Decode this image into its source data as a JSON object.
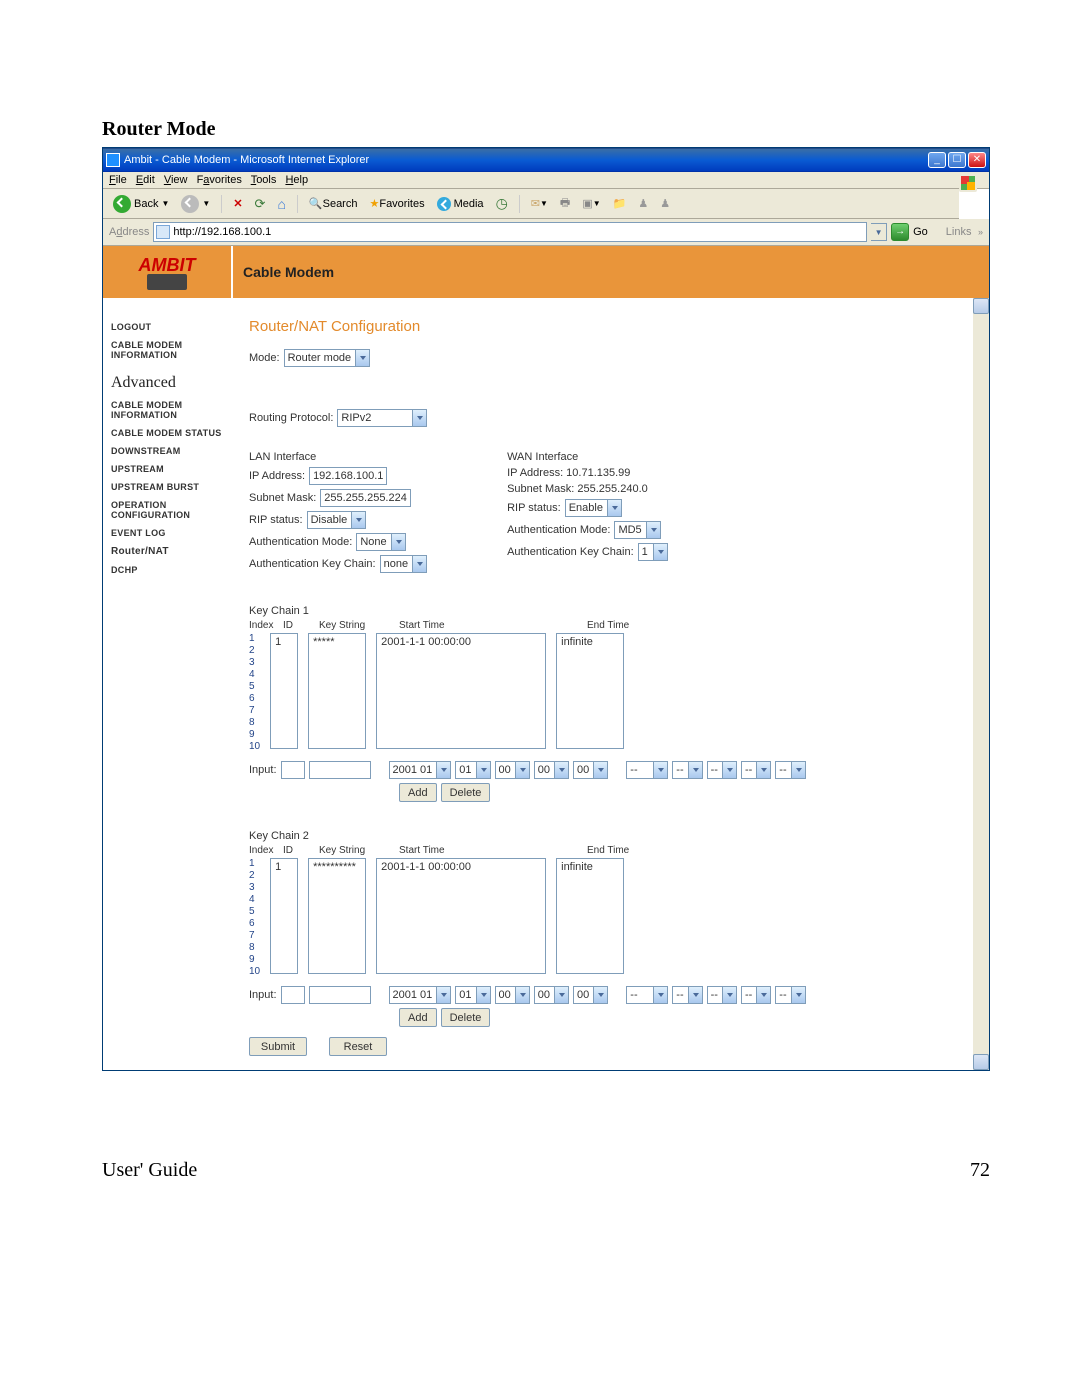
{
  "doc": {
    "heading": "Router Mode",
    "footer_left": "User' Guide",
    "footer_right": "72"
  },
  "window": {
    "title": "Ambit - Cable Modem - Microsoft Internet Explorer"
  },
  "menu": {
    "file": "File",
    "edit": "Edit",
    "view": "View",
    "fav": "Favorites",
    "tools": "Tools",
    "help": "Help"
  },
  "tb": {
    "back": "Back",
    "search": "Search",
    "favorites": "Favorites",
    "media": "Media"
  },
  "addr": {
    "label": "Address",
    "value": "http://192.168.100.1",
    "go": "Go",
    "links": "Links"
  },
  "brand": {
    "logo": "AMBIT",
    "banner": "Cable Modem"
  },
  "nav": {
    "i0": "LOGOUT",
    "i1": "CABLE MODEM INFORMATION",
    "adv": "Advanced",
    "i2": "CABLE MODEM INFORMATION",
    "i3": "CABLE MODEM STATUS",
    "i4": "DOWNSTREAM",
    "i5": "UPSTREAM",
    "i6": "UPSTREAM BURST",
    "i7": "OPERATION CONFIGURATION",
    "i8": "EVENT LOG",
    "i9": "Router/NAT",
    "i10": "DCHP"
  },
  "cfg": {
    "title": "Router/NAT Configuration",
    "mode_label": "Mode:",
    "mode_value": "Router mode",
    "rp_label": "Routing Protocol:",
    "rp_value": "RIPv2",
    "lan": {
      "title": "LAN Interface",
      "ip_label": "IP Address:",
      "ip": "192.168.100.1",
      "mask_label": "Subnet Mask:",
      "mask": "255.255.255.224",
      "rip_label": "RIP status:",
      "rip": "Disable",
      "auth_label": "Authentication Mode:",
      "auth": "None",
      "akc_label": "Authentication Key Chain:",
      "akc": "none"
    },
    "wan": {
      "title": "WAN Interface",
      "ip_label": "IP Address: 10.71.135.99",
      "mask_label": "Subnet Mask: 255.255.240.0",
      "rip_label": "RIP status:",
      "rip": "Enable",
      "auth_label": "Authentication Mode:",
      "auth": "MD5",
      "akc_label": "Authentication Key Chain:",
      "akc": "1"
    }
  },
  "kc1": {
    "title": "Key Chain 1",
    "hdr": {
      "index": "Index",
      "id": "ID",
      "ks": "Key String",
      "st": "Start Time",
      "et": "End Time"
    },
    "id": "1",
    "ks": "*****",
    "st": "2001-1-1 00:00:00",
    "et": "infinite",
    "input_label": "Input:",
    "s1": "2001 01",
    "s2": "01",
    "s3": "00",
    "s4": "00",
    "s5": "00",
    "dd": "--",
    "add": "Add",
    "del": "Delete"
  },
  "kc2": {
    "title": "Key Chain 2",
    "hdr": {
      "index": "Index",
      "id": "ID",
      "ks": "Key String",
      "st": "Start Time",
      "et": "End Time"
    },
    "id": "1",
    "ks": "**********",
    "st": "2001-1-1 00:00:00",
    "et": "infinite",
    "input_label": "Input:",
    "s1": "2001 01",
    "s2": "01",
    "s3": "00",
    "s4": "00",
    "s5": "00",
    "dd": "--",
    "add": "Add",
    "del": "Delete"
  },
  "form": {
    "submit": "Submit",
    "reset": "Reset"
  },
  "idx": [
    "1",
    "2",
    "3",
    "4",
    "5",
    "6",
    "7",
    "8",
    "9",
    "10"
  ]
}
